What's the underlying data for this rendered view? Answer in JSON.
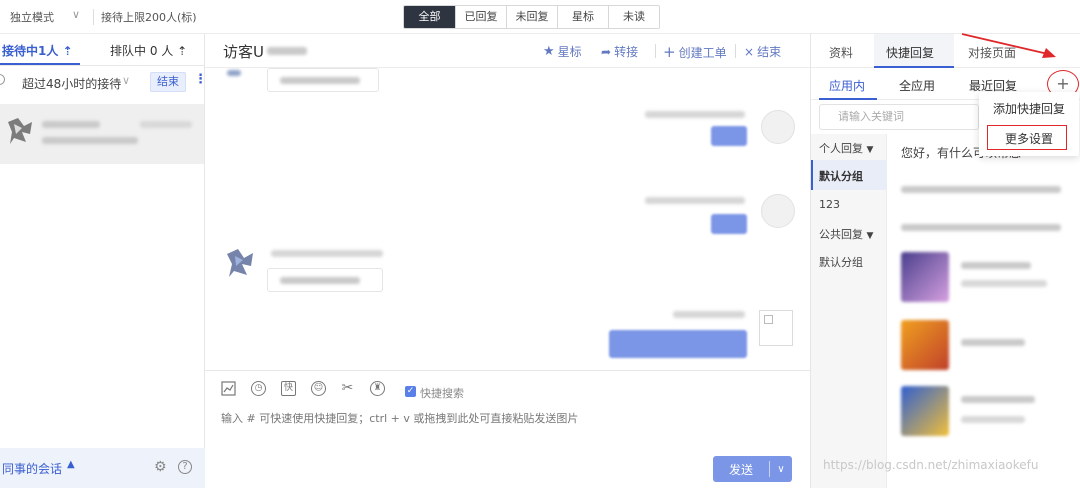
{
  "topbar": {
    "mode": "独立模式",
    "limit": "接待上限200人(标)",
    "filter_tabs": [
      "全部",
      "已回复",
      "未回复",
      "星标",
      "未读"
    ],
    "active_filter": "全部"
  },
  "left": {
    "tab_serving": "接待中1人",
    "tab_queue": "排队中 0 人",
    "filter_label": "超过48小时的接待",
    "end_button": "结束",
    "footer_text": "同事的会话"
  },
  "chat": {
    "visitor_title": "访客U",
    "actions": {
      "star": "星标",
      "transfer": "转接",
      "create_ticket": "创建工单",
      "end": "结束"
    },
    "quick_search_label": "快捷搜索",
    "input_placeholder": "输入 # 可快速使用快捷回复；ctrl + v 或拖拽到此处可直接粘贴发送图片",
    "send_label": "发送"
  },
  "right": {
    "tabs": [
      "资料",
      "快捷回复",
      "对接页面"
    ],
    "active_tab": "快捷回复",
    "subtabs": [
      "应用内",
      "全应用",
      "最近回复"
    ],
    "active_subtab": "应用内",
    "plus": "+",
    "keyword_placeholder": "请输入关键词",
    "categories": {
      "personal": "个人回复",
      "default_group": "默认分组",
      "group_123": "123",
      "public": "公共回复",
      "public_default": "默认分组"
    },
    "greeting": "您好，有什么可以帮您",
    "dropdown": {
      "add_quick_reply": "添加快捷回复",
      "more_settings": "更多设置"
    }
  },
  "watermark": "https://blog.csdn.net/zhimaxiaokefu",
  "colors": {
    "accent": "#3a5fd0",
    "send_button": "#7b96e6",
    "highlight_red": "#e0282a"
  }
}
